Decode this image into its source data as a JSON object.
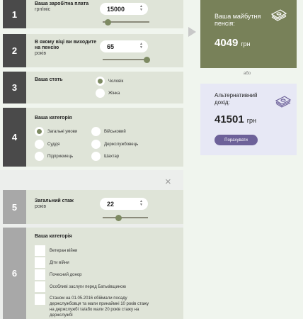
{
  "step1": {
    "number": "1",
    "label": "Ваша заробітна плата",
    "sublabel": "грн/міс",
    "value": "15000"
  },
  "step2": {
    "number": "2",
    "label": "В якому віці ви виходите на пенсію",
    "sublabel": "років",
    "value": "65"
  },
  "step3": {
    "number": "3",
    "label": "Ваша стать",
    "options": [
      "Чоловік",
      "Жінка"
    ],
    "selected": "Чоловік"
  },
  "step4": {
    "number": "4",
    "label": "Ваша категорія",
    "options": [
      "Загальні умови",
      "Військовий",
      "Суддя",
      "Держслужбовець",
      "Підприємець",
      "Шахтар"
    ],
    "selected": "Загальні умови"
  },
  "step5": {
    "number": "5",
    "label": "Загальний стаж",
    "sublabel": "років",
    "value": "22"
  },
  "step6": {
    "number": "6",
    "label": "Ваша категорія",
    "options": [
      "Ветеран війни",
      "Діти війни",
      "Почесний донор",
      "Особливі заслуги перед Батьківщиною",
      "Станом на 01.05.2016 обіймали посаду держслужбовця та мали принаймні 10 років стажу на держслужбі та/або мали 20 років стажу на держслужбі"
    ]
  },
  "future_pension": {
    "title_line1": "Ваша майбутня",
    "title_line2": "пенсія:",
    "amount": "4049",
    "unit": "грн"
  },
  "or_label": "або",
  "alt_income": {
    "title_line1": "Альтернативний",
    "title_line2": "дохід:",
    "amount": "41501",
    "unit": "грн",
    "button": "Порахувати"
  },
  "close_symbol": "×",
  "colors": {
    "accent": "#788159",
    "button": "#6d6199",
    "panel": "#dfe4d8"
  }
}
